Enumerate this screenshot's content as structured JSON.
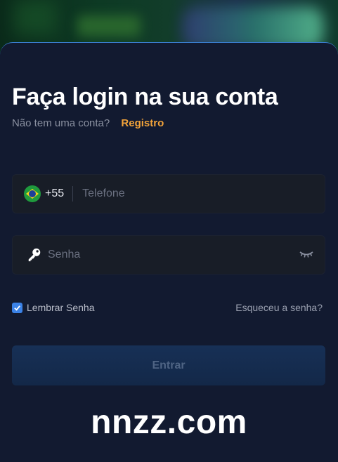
{
  "login": {
    "title": "Faça login na sua conta",
    "no_account": "Não tem uma conta?",
    "register_link": "Registro",
    "phone": {
      "country_code": "+55",
      "placeholder": "Telefone"
    },
    "password": {
      "placeholder": "Senha"
    },
    "remember_label": "Lembrar Senha",
    "remember_checked": true,
    "forgot_link": "Esqueceu a senha?",
    "submit_label": "Entrar"
  },
  "watermark": "nnzz.com",
  "icons": {
    "flag": "brazil-flag-icon",
    "key": "key-icon",
    "eye": "eye-closed-icon",
    "check": "checkmark-icon"
  },
  "colors": {
    "accent": "#f2a33a",
    "checkbox": "#3b82e6",
    "card_bg": "#121a30",
    "field_bg": "#181d27",
    "button_bg": "#173056"
  }
}
